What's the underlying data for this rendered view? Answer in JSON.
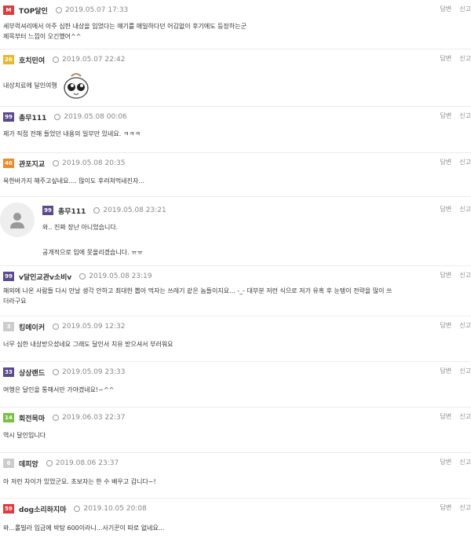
{
  "actions": {
    "reply": "답변",
    "report": "신고"
  },
  "comments": [
    {
      "badge": "M",
      "badge_color": "#e03a3a",
      "nick": "TOP달인",
      "date": "2019.05.07 17:33",
      "lines": [
        "세부럭셔리에서 아주 심한 내상을 입었다는 얘기를 매일하다던 어김없이 후기에도 등장하는군",
        "제목부터 느낌이 오긴했어^^"
      ]
    },
    {
      "badge": "26",
      "badge_color": "#e9b92a",
      "nick": "호치민여",
      "date": "2019.05.07 22:42",
      "lines": [
        "내상치료에  달인여행"
      ]
    },
    {
      "badge": "99",
      "badge_color": "#5b4a8c",
      "nick": "총무111",
      "date": "2019.05.08 00:06",
      "lines": [
        "제가 직접 전해 들었던 내용의 일부만 있네요. ㅋㅋㅋ"
      ]
    },
    {
      "badge": "46",
      "badge_color": "#f08a24",
      "nick": "관포지교",
      "date": "2019.05.08 20:35",
      "lines": [
        "욕한바가지 해주고싶네요.... 많이도 후려쳐먹네진자..."
      ]
    },
    {
      "badge": "99",
      "badge_color": "#5b4a8c",
      "nick": "총무111",
      "date": "2019.05.08 23:21",
      "lines": [
        "와.. 진짜 장난 아니었습니다.",
        "",
        "공개적으로 입에 못올리겠습니다. ㅠㅠ"
      ]
    },
    {
      "badge": "99",
      "badge_color": "#5b4a8c",
      "nick": "v달인교관v소비v",
      "date": "2019.05.08 23:19",
      "lines": [
        "해외에 나온 사람들 다시 만날 생각 안하고 최대한 뽑아 먹자는 쓰레기 같은 놈들이지요... -_- 대부분 저런 식으로 저가 유혹 후 눈탱이 전략을 많이 쓰",
        "더라구요"
      ]
    },
    {
      "badge": "3",
      "badge_color": "#cccccc",
      "nick": "킹메이커",
      "date": "2019.05.09 12:32",
      "lines": [
        "너무 심한 내상받으셨네요 그래도 달인서 치유 받으셔서 부러워요"
      ]
    },
    {
      "badge": "33",
      "badge_color": "#5b4a8c",
      "nick": "상상랜드",
      "date": "2019.05.09 23:33",
      "lines": [
        "여행은 달인을 통해서만 가야겠네요!~^^"
      ]
    },
    {
      "badge": "14",
      "badge_color": "#7ac142",
      "nick": "회전목마",
      "date": "2019.06.03 22:37",
      "lines": [
        "역시 달인입니다"
      ]
    },
    {
      "badge": "6",
      "badge_color": "#cccccc",
      "nick": "데피앙",
      "date": "2019.08.06 23:37",
      "lines": [
        "아 저런 차이가 있었군요. 초보자는 한 수 배우고 갑니다~!"
      ]
    },
    {
      "badge": "59",
      "badge_color": "#e03a3a",
      "nick": "dog소리하지마",
      "date": "2019.10.05 20:08",
      "lines": [
        "와...롤빌라 입금에 박탕 600이라니...사기꾼이 따로 없네요..."
      ]
    }
  ]
}
